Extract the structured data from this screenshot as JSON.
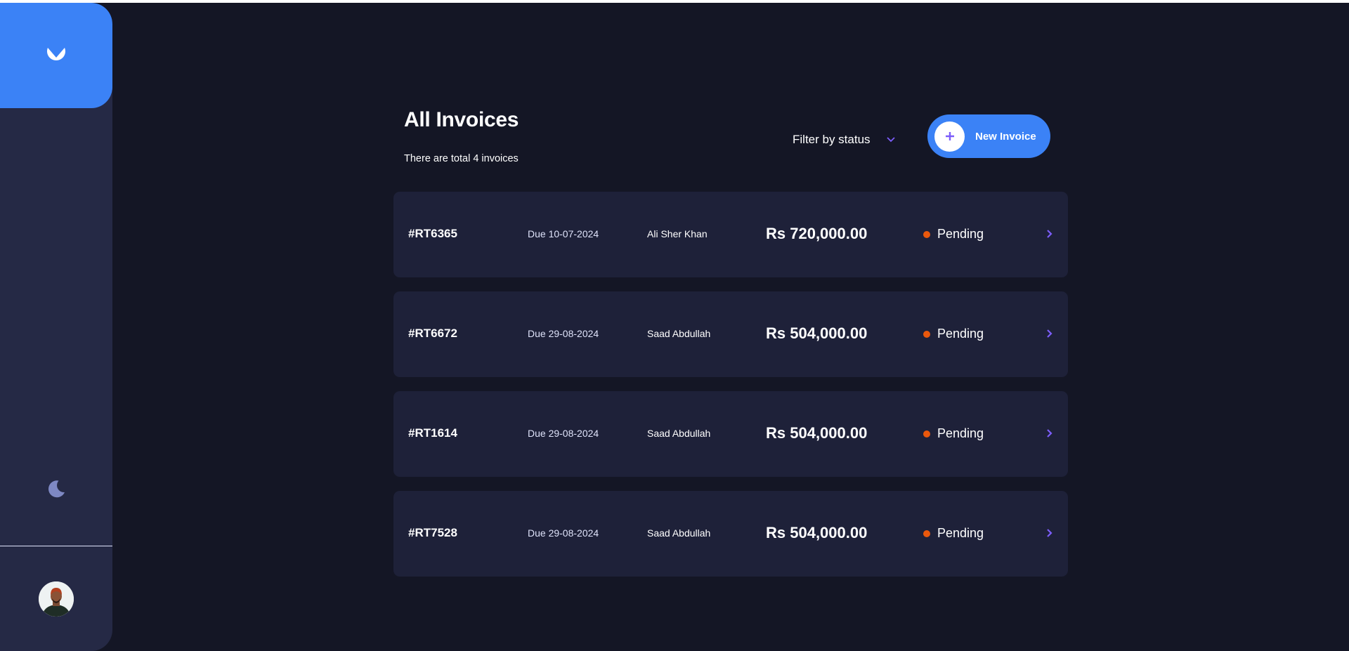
{
  "header": {
    "title": "All Invoices",
    "subtitle": "There are total 4 invoices",
    "filter_label": "Filter by status",
    "new_invoice_label": "New Invoice"
  },
  "sidebar": {
    "logo_icon": "logo-icon",
    "theme_icon": "moon-icon",
    "avatar_icon": "avatar"
  },
  "invoices": [
    {
      "id": "#RT6365",
      "due": "Due 10-07-2024",
      "client": "Ali Sher Khan",
      "amount": "Rs 720,000.00",
      "status": "Pending"
    },
    {
      "id": "#RT6672",
      "due": "Due 29-08-2024",
      "client": "Saad Abdullah",
      "amount": "Rs 504,000.00",
      "status": "Pending"
    },
    {
      "id": "#RT1614",
      "due": "Due 29-08-2024",
      "client": "Saad Abdullah",
      "amount": "Rs 504,000.00",
      "status": "Pending"
    },
    {
      "id": "#RT7528",
      "due": "Due 29-08-2024",
      "client": "Saad Abdullah",
      "amount": "Rs 504,000.00",
      "status": "Pending"
    }
  ],
  "colors": {
    "background": "#141625",
    "sidebar": "#252945",
    "accent": "#3b82f6",
    "card": "#1e2139",
    "pending": "#ea580c",
    "arrow": "#7c5dfa"
  }
}
